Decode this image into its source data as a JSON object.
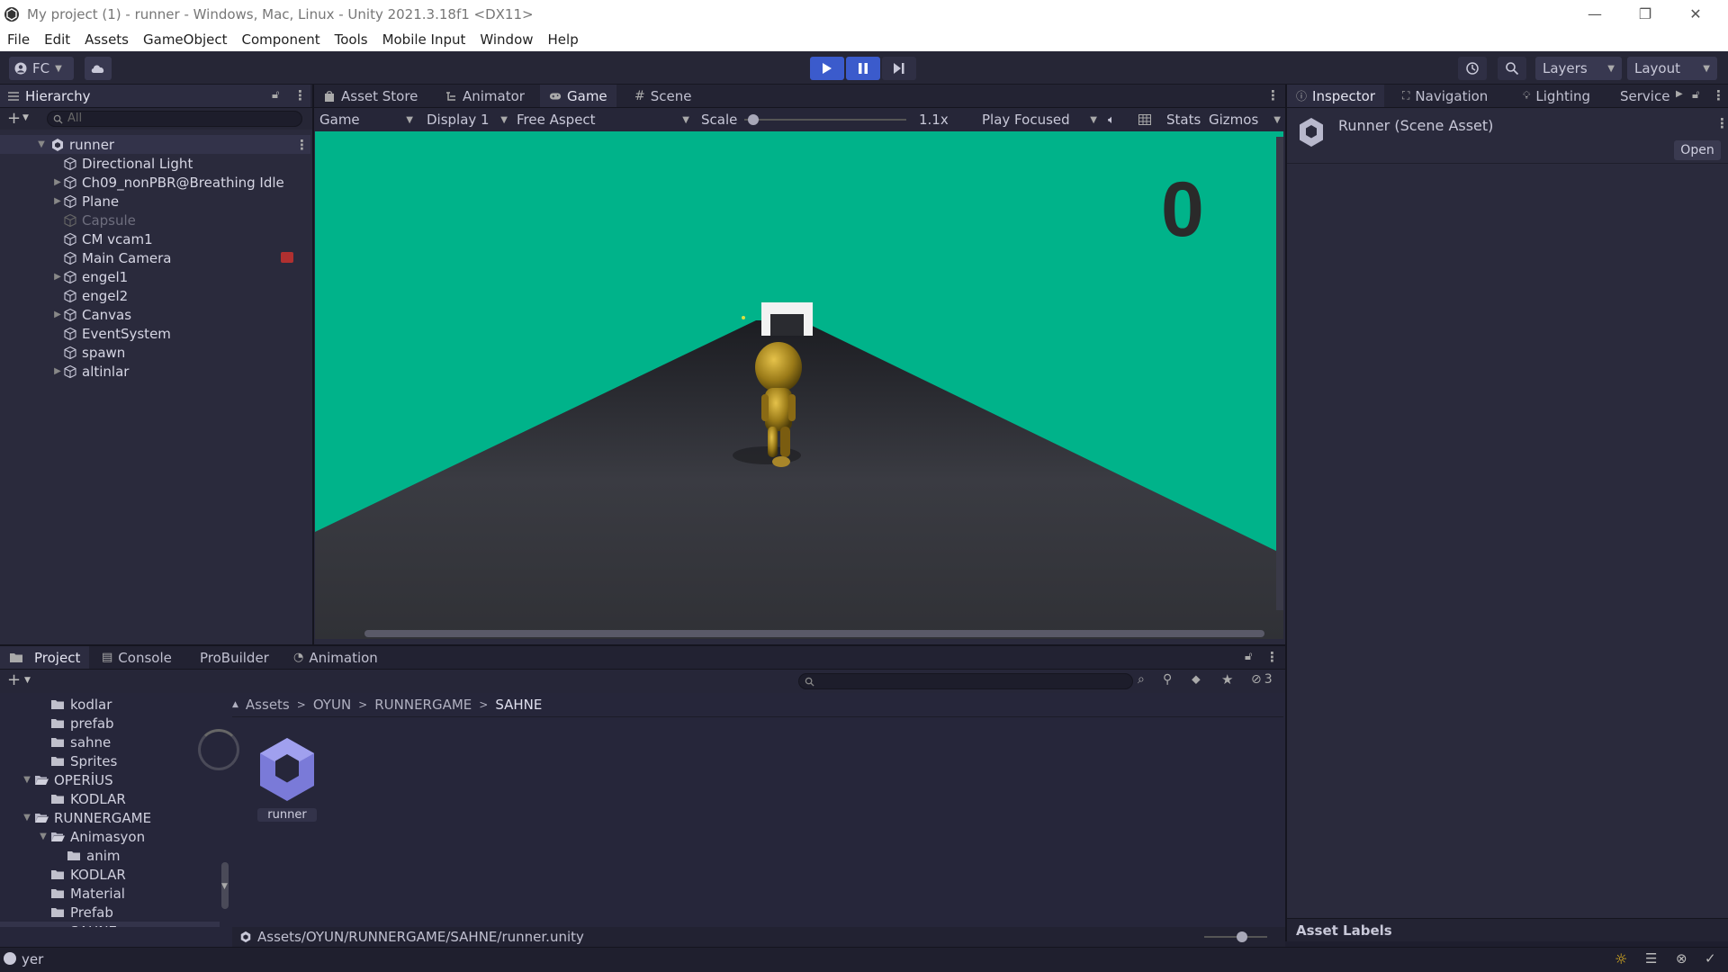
{
  "titlebar": {
    "title": "My project (1) - runner - Windows, Mac, Linux - Unity 2021.3.18f1 <DX11>"
  },
  "menu": [
    "File",
    "Edit",
    "Assets",
    "GameObject",
    "Component",
    "Tools",
    "Mobile Input",
    "Window",
    "Help"
  ],
  "toolbar": {
    "account": "FC",
    "layers": "Layers",
    "layout": "Layout"
  },
  "hierarchy": {
    "tab": "Hierarchy",
    "search_placeholder": "All",
    "scene": "runner",
    "items": [
      {
        "label": "Directional Light",
        "expandable": false,
        "disabled": false
      },
      {
        "label": "Ch09_nonPBR@Breathing Idle",
        "expandable": true,
        "disabled": false
      },
      {
        "label": "Plane",
        "expandable": true,
        "disabled": false
      },
      {
        "label": "Capsule",
        "expandable": false,
        "disabled": true
      },
      {
        "label": "CM vcam1",
        "expandable": false,
        "disabled": false
      },
      {
        "label": "Main Camera",
        "expandable": false,
        "disabled": false
      },
      {
        "label": "engel1",
        "expandable": true,
        "disabled": false
      },
      {
        "label": "engel2",
        "expandable": false,
        "disabled": false
      },
      {
        "label": "Canvas",
        "expandable": true,
        "disabled": false
      },
      {
        "label": "EventSystem",
        "expandable": false,
        "disabled": false
      },
      {
        "label": "spawn",
        "expandable": false,
        "disabled": false
      },
      {
        "label": "altinlar",
        "expandable": true,
        "disabled": false
      }
    ]
  },
  "center_tabs": [
    "Asset Store",
    "Animator",
    "Game",
    "Scene"
  ],
  "game": {
    "mode": "Game",
    "display": "Display 1",
    "aspect": "Free Aspect",
    "scale_label": "Scale",
    "scale_value": "1.1x",
    "play_mode": "Play Focused",
    "stats": "Stats",
    "gizmos": "Gizmos",
    "score": "0",
    "sky_color": "#00b38a"
  },
  "inspector": {
    "tabs": [
      "Inspector",
      "Navigation",
      "Lighting",
      "Service"
    ],
    "title": "Runner (Scene Asset)",
    "open_button": "Open",
    "asset_labels": "Asset Labels"
  },
  "bottom_tabs": [
    "Project",
    "Console",
    "ProBuilder",
    "Animation"
  ],
  "project": {
    "hidden_count": "3",
    "tree": [
      {
        "label": "kodlar",
        "depth": 2,
        "expanded": null
      },
      {
        "label": "prefab",
        "depth": 2,
        "expanded": null
      },
      {
        "label": "sahne",
        "depth": 2,
        "expanded": null
      },
      {
        "label": "Sprites",
        "depth": 2,
        "expanded": null
      },
      {
        "label": "OPERİUS",
        "depth": 1,
        "expanded": true
      },
      {
        "label": "KODLAR",
        "depth": 2,
        "expanded": null
      },
      {
        "label": "RUNNERGAME",
        "depth": 1,
        "expanded": true
      },
      {
        "label": "Animasyon",
        "depth": 2,
        "expanded": true
      },
      {
        "label": "anim",
        "depth": 3,
        "expanded": null
      },
      {
        "label": "KODLAR",
        "depth": 2,
        "expanded": null
      },
      {
        "label": "Material",
        "depth": 2,
        "expanded": null
      },
      {
        "label": "Prefab",
        "depth": 2,
        "expanded": null
      },
      {
        "label": "SAHNE",
        "depth": 2,
        "expanded": null,
        "selected": true
      }
    ],
    "breadcrumb": [
      "Assets",
      "OYUN",
      "RUNNERGAME",
      "SAHNE"
    ],
    "asset_name": "runner",
    "path": "Assets/OYUN/RUNNERGAME/SAHNE/runner.unity"
  },
  "status": {
    "message": "yer"
  }
}
